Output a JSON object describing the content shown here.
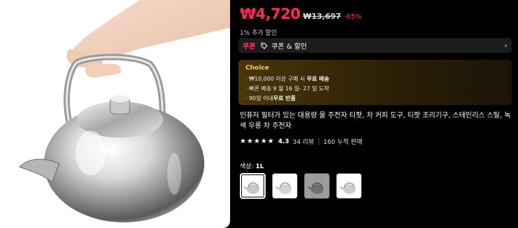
{
  "product": {
    "price": "₩4,720",
    "original_price": "₩13,697",
    "discount": "-65%",
    "extra_discount": "1% 추가 할인",
    "coupon": {
      "tag": "쿠폰",
      "text": "쿠폰 & 할인",
      "icon": "tag-icon"
    },
    "choice": {
      "title": "Choice",
      "line1_prefix": "· ₩10,000 이상 구매 시 ",
      "line1_bold": "무료 배송",
      "line2_prefix": "· 빠른 배송 9 월 16 일- 27 일 도착",
      "line3_prefix": "· 90일 이내",
      "line3_bold": "무료 반품"
    },
    "title": "인퓨저 필터가 있는 대용량 물 주전자 티팟, 차 커피 도구, 티팟 조리기구, 스테인리스 스틸, 녹색 우롱 차 주전자",
    "rating": "4.3",
    "reviews": "34 리뷰",
    "separator": "|",
    "sold": "160 누적 판매",
    "color_label_prefix": "색상: ",
    "color_value": "1L"
  },
  "colors": {
    "price": "#ff2a55",
    "choice_title": "#ffcf3a"
  }
}
